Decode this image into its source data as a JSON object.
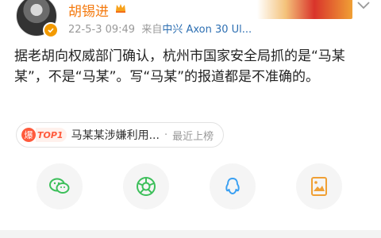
{
  "header": {
    "username": "胡锡进",
    "timestamp": "22-5-3 09:49",
    "source_prefix": "来自",
    "source": "中兴 Axon 30 Ul...",
    "icons": {
      "avatar": "avatar",
      "verified": "verified-badge-icon",
      "vip": "vip-crown-icon",
      "more": "chevron-down-icon"
    },
    "colors": {
      "username": "#f47a0f",
      "source": "#2d6fb2",
      "meta": "#999999"
    }
  },
  "post": {
    "text": "据老胡向权威部门确认，杭州市国家安全局抓的是“马某某”，不是“马某”。写“马某”的报道都是不准确的。"
  },
  "hot_topic": {
    "badge_icon": "爆",
    "badge_rank": "TOP1",
    "title": "马某某涉嫌利用...",
    "separator": "·",
    "desc": "最近上榜",
    "colors": {
      "badge": "#ff5a3c"
    }
  },
  "share": {
    "buttons": [
      {
        "name": "wechat-icon"
      },
      {
        "name": "moments-icon"
      },
      {
        "name": "qq-icon"
      },
      {
        "name": "image-share-icon"
      }
    ],
    "colors": {
      "wechat": "#3cbf5a",
      "moments": "#3cbf5a",
      "qq": "#3aa0f2",
      "image": "#f0a035"
    }
  }
}
